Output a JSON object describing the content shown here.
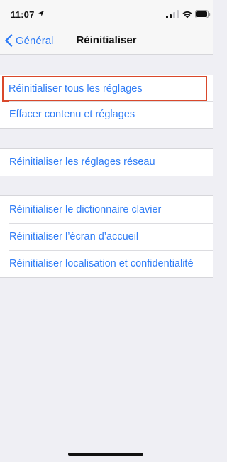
{
  "status_bar": {
    "time": "11:07"
  },
  "nav": {
    "back_label": "Général",
    "title": "Réinitialiser"
  },
  "groups": [
    {
      "items": [
        {
          "label": "Réinitialiser tous les réglages",
          "highlighted": true
        },
        {
          "label": "Effacer contenu et réglages"
        }
      ]
    },
    {
      "items": [
        {
          "label": "Réinitialiser les réglages réseau"
        }
      ]
    },
    {
      "items": [
        {
          "label": "Réinitialiser le dictionnaire clavier"
        },
        {
          "label": "Réinitialiser l’écran d’accueil"
        },
        {
          "label": "Réinitialiser localisation et confidentialité"
        }
      ]
    }
  ],
  "colors": {
    "accent": "#2f7cf6",
    "highlight_border": "#d9482b",
    "background": "#efeff4"
  }
}
